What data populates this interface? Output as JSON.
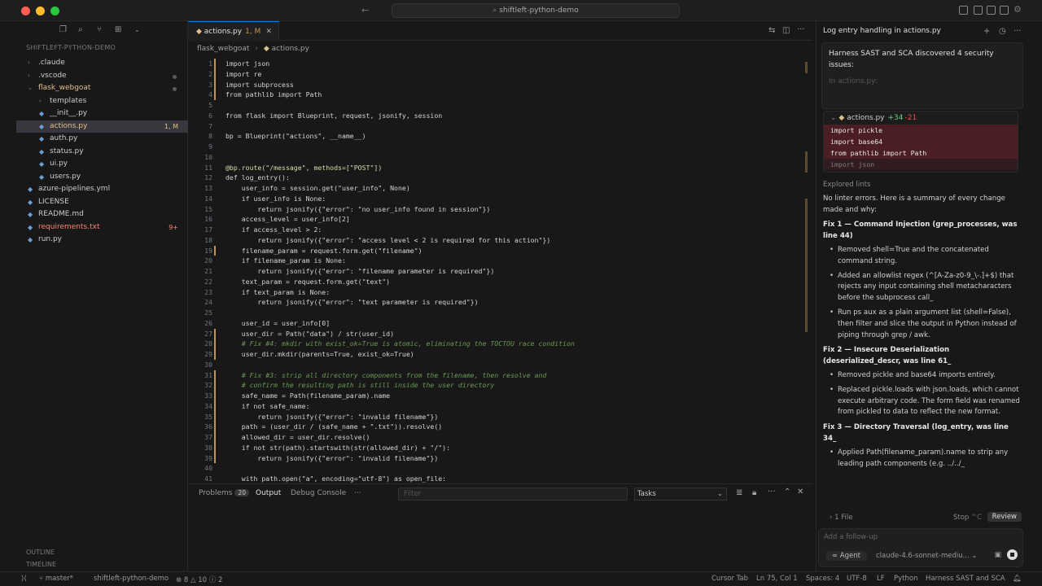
{
  "titlebar": {
    "search": "shiftleft-python-demo"
  },
  "explorer": {
    "title": "SHIFTLEFT-PYTHON-DEMO",
    "items": [
      {
        "label": ".claude",
        "indent": 0,
        "folder": true,
        "color": "#cccccc"
      },
      {
        "label": ".vscode",
        "indent": 0,
        "folder": true,
        "color": "#cccccc",
        "dot": true
      },
      {
        "label": "flask_webgoat",
        "indent": 0,
        "folder": true,
        "open": true,
        "color": "#e2c08d",
        "dot": true
      },
      {
        "label": "templates",
        "indent": 1,
        "folder": true,
        "color": "#cccccc"
      },
      {
        "label": "__init__.py",
        "indent": 1,
        "color": "#cccccc"
      },
      {
        "label": "actions.py",
        "indent": 1,
        "color": "#e2c08d",
        "badge": "1, M",
        "selected": true
      },
      {
        "label": "auth.py",
        "indent": 1,
        "color": "#cccccc"
      },
      {
        "label": "status.py",
        "indent": 1,
        "color": "#cccccc"
      },
      {
        "label": "ui.py",
        "indent": 1,
        "color": "#cccccc"
      },
      {
        "label": "users.py",
        "indent": 1,
        "color": "#cccccc"
      },
      {
        "label": "azure-pipelines.yml",
        "indent": 0,
        "color": "#cccccc"
      },
      {
        "label": "LICENSE",
        "indent": 0,
        "color": "#cccccc"
      },
      {
        "label": "README.md",
        "indent": 0,
        "color": "#cccccc"
      },
      {
        "label": "requirements.txt",
        "indent": 0,
        "color": "#f48771",
        "badge": "9+"
      },
      {
        "label": "run.py",
        "indent": 0,
        "color": "#cccccc"
      }
    ],
    "outline": "OUTLINE",
    "timeline": "TIMELINE"
  },
  "editor": {
    "tab": {
      "label": "actions.py",
      "status": "1, M"
    },
    "breadcrumbs": [
      "flask_webgoat",
      "actions.py"
    ],
    "lines": [
      {
        "n": "1",
        "t": "import json"
      },
      {
        "n": "2",
        "t": "import re"
      },
      {
        "n": "3",
        "t": "import subprocess"
      },
      {
        "n": "4",
        "t": "from pathlib import Path"
      },
      {
        "n": "5",
        "t": ""
      },
      {
        "n": "6",
        "t": "from flask import Blueprint, request, jsonify, session"
      },
      {
        "n": "7",
        "t": ""
      },
      {
        "n": "8",
        "t": "bp = Blueprint(\"actions\", __name__)"
      },
      {
        "n": "9",
        "t": ""
      },
      {
        "n": "10",
        "t": ""
      },
      {
        "n": "11",
        "t": "@bp.route(\"/message\", methods=[\"POST\"])"
      },
      {
        "n": "12",
        "t": "def log_entry():"
      },
      {
        "n": "13",
        "t": "    user_info = session.get(\"user_info\", None)"
      },
      {
        "n": "14",
        "t": "    if user_info is None:"
      },
      {
        "n": "15",
        "t": "        return jsonify({\"error\": \"no user_info found in session\"})"
      },
      {
        "n": "16",
        "t": "    access_level = user_info[2]"
      },
      {
        "n": "17",
        "t": "    if access_level > 2:"
      },
      {
        "n": "18",
        "t": "        return jsonify({\"error\": \"access level < 2 is required for this action\"})"
      },
      {
        "n": "19",
        "t": "    filename_param = request.form.get(\"filename\")"
      },
      {
        "n": "20",
        "t": "    if filename_param is None:"
      },
      {
        "n": "21",
        "t": "        return jsonify({\"error\": \"filename parameter is required\"})"
      },
      {
        "n": "22",
        "t": "    text_param = request.form.get(\"text\")"
      },
      {
        "n": "23",
        "t": "    if text_param is None:"
      },
      {
        "n": "24",
        "t": "        return jsonify({\"error\": \"text parameter is required\"})"
      },
      {
        "n": "25",
        "t": ""
      },
      {
        "n": "26",
        "t": "    user_id = user_info[0]"
      },
      {
        "n": "27",
        "t": "    user_dir = Path(\"data\") / str(user_id)"
      },
      {
        "n": "28",
        "t": "    # Fix #4: mkdir with exist_ok=True is atomic, eliminating the TOCTOU race condition"
      },
      {
        "n": "29",
        "t": "    user_dir.mkdir(parents=True, exist_ok=True)"
      },
      {
        "n": "30",
        "t": ""
      },
      {
        "n": "31",
        "t": "    # Fix #3: strip all directory components from the filename, then resolve and"
      },
      {
        "n": "32",
        "t": "    # confirm the resulting path is still inside the user directory"
      },
      {
        "n": "33",
        "t": "    safe_name = Path(filename_param).name"
      },
      {
        "n": "34",
        "t": "    if not safe_name:"
      },
      {
        "n": "35",
        "t": "        return jsonify({\"error\": \"invalid filename\"})"
      },
      {
        "n": "36",
        "t": "    path = (user_dir / (safe_name + \".txt\")).resolve()"
      },
      {
        "n": "37",
        "t": "    allowed_dir = user_dir.resolve()"
      },
      {
        "n": "38",
        "t": "    if not str(path).startswith(str(allowed_dir) + \"/\"):"
      },
      {
        "n": "39",
        "t": "        return jsonify({\"error\": \"invalid filename\"})"
      },
      {
        "n": "40",
        "t": ""
      },
      {
        "n": "41",
        "t": "    with path.open(\"a\", encoding=\"utf-8\") as open_file:"
      }
    ]
  },
  "panel": {
    "tabs": [
      "Problems",
      "Output",
      "Debug Console",
      "···"
    ],
    "problems_count": "20",
    "filter_placeholder": "Filter",
    "select_value": "Tasks"
  },
  "chat": {
    "title": "Log entry handling in actions.py",
    "message": "Harness SAST and SCA discovered 4 security issues:",
    "message_faded": "In actions.py:",
    "diff": {
      "file": "actions.py",
      "added": "+34",
      "removed": "-21",
      "lines": [
        "import pickle",
        "import base64",
        "from pathlib import Path",
        "import json"
      ]
    },
    "explored": "Explored lints",
    "summary": "No linter errors. Here is a summary of every change made and why:",
    "fix1": {
      "title": "Fix 1 — Command Injection (grep_processes, was line 44)",
      "b1": "Removed shell=True and the concatenated command string.",
      "b2": "Added an allowlist regex (^[A-Za-z0-9_\\-.]+$) that rejects any input containing shell metacharacters before the subprocess call_",
      "b3": "Run ps aux as a plain argument list (shell=False), then filter and slice the output in Python instead of piping through grep / awk."
    },
    "fix2": {
      "title": "Fix 2 — Insecure Deserialization (deserialized_descr, was line 61_",
      "b1": "Removed pickle and base64 imports entirely.",
      "b2": "Replaced pickle.loads with json.loads, which cannot execute arbitrary code. The form field was renamed from pickled to data to reflect the new format."
    },
    "fix3": {
      "title": "Fix 3 — Directory Traversal (log_entry, was line 34_",
      "b1": "Applied Path(filename_param).name to strip any leading path components (e.g. ../../_"
    },
    "files": "1 File",
    "stop": "Stop",
    "stop_key": "^C",
    "review": "Review",
    "input_placeholder": "Add a follow-up",
    "agent": "Agent",
    "model": "claude-4.6-sonnet-mediu..."
  },
  "statusbar": {
    "branch": "master*",
    "project": "shiftleft-python-demo",
    "errors": "8",
    "warnings": "10",
    "info": "2",
    "cursor_tab": "Cursor Tab",
    "position": "Ln 75, Col 1",
    "spaces": "Spaces: 4",
    "encoding": "UTF-8",
    "eol": "LF",
    "language": "Python",
    "extension": "Harness SAST and SCA"
  }
}
